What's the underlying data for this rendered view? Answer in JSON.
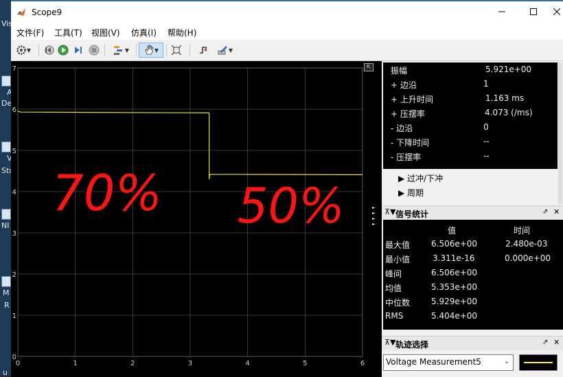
{
  "window": {
    "title": "Scope9"
  },
  "desktop": {
    "labels": [
      "Vis",
      "A",
      "De",
      "V",
      "Stu",
      "NI",
      "M",
      "R",
      "u"
    ]
  },
  "menu": [
    "文件(F)",
    "工具(T)",
    "视图(V)",
    "仿真(I)",
    "帮助(H)"
  ],
  "icons": {
    "toolbar": [
      "settings-icon",
      "step-back-icon",
      "run-icon",
      "step-forward-icon",
      "stop-icon",
      "highlight-icon",
      "pan-icon",
      "zoom-fit-icon",
      "trigger-icon",
      "style-icon"
    ],
    "panel": [
      "collapse-icon",
      "undock-icon",
      "close-icon"
    ]
  },
  "plot": {
    "background": "#000000",
    "grid_color": "#4a4a4a",
    "signal_color": "#e6e61e",
    "x_ticks": [
      "0",
      "1",
      "2",
      "3",
      "4",
      "5",
      "6"
    ],
    "y_ticks": [
      "0",
      "1",
      "2",
      "3",
      "4",
      "5",
      "6",
      "7"
    ],
    "annotations": [
      "70%",
      "50%"
    ]
  },
  "chart_data": {
    "type": "line",
    "xlim": [
      0,
      6
    ],
    "ylim": [
      0,
      7
    ],
    "grid": true,
    "series": [
      {
        "x": [
          0,
          0.05,
          3.33,
          3.33,
          3.34,
          6
        ],
        "y": [
          5.95,
          5.93,
          5.91,
          4.3,
          4.42,
          4.41
        ]
      }
    ],
    "x_ticks": [
      0,
      1,
      2,
      3,
      4,
      5,
      6
    ],
    "y_ticks": [
      0,
      1,
      2,
      3,
      4,
      5,
      6,
      7
    ]
  },
  "measurements": {
    "rows": [
      {
        "label": "振幅",
        "value": "5.921e+00"
      },
      {
        "label": "+ 边沿",
        "value": "1"
      },
      {
        "label": "+ 上升时间",
        "value": "1.163 ms"
      },
      {
        "label": "+ 压摆率",
        "value": "4.073 (/ms)"
      },
      {
        "label": "- 边沿",
        "value": "0"
      },
      {
        "label": "- 下降时间",
        "value": "--"
      },
      {
        "label": "- 压摆率",
        "value": "--"
      }
    ],
    "sections": [
      "过冲/下冲",
      "周期"
    ]
  },
  "signal_stats": {
    "title": "信号统计",
    "headers": [
      "值",
      "时间"
    ],
    "rows": [
      {
        "label": "最大值",
        "value": "6.506e+00",
        "time": "2.480e-03"
      },
      {
        "label": "最小值",
        "value": "3.311e-16",
        "time": "0.000e+00"
      },
      {
        "label": "峰间",
        "value": "6.506e+00",
        "time": ""
      },
      {
        "label": "均值",
        "value": "5.353e+00",
        "time": ""
      },
      {
        "label": "中位数",
        "value": "5.929e+00",
        "time": ""
      },
      {
        "label": "RMS",
        "value": "5.404e+00",
        "time": ""
      }
    ]
  },
  "trace": {
    "title": "轨迹选择",
    "selected": "Voltage Measurement5",
    "line_color": "#ffff00"
  }
}
